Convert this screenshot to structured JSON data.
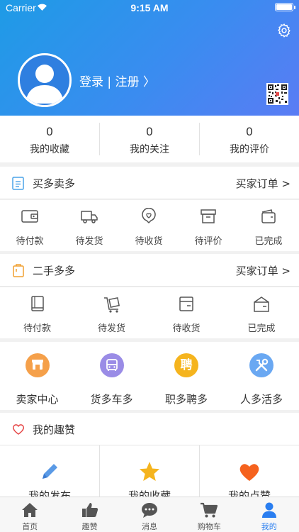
{
  "status_bar": {
    "carrier": "Carrier",
    "time": "9:15 AM"
  },
  "profile": {
    "login_text": "登录 | 注册 〉"
  },
  "stats": [
    {
      "value": "0",
      "label": "我的收藏"
    },
    {
      "value": "0",
      "label": "我的关注"
    },
    {
      "value": "0",
      "label": "我的评价"
    }
  ],
  "section_buy": {
    "title": "买多卖多",
    "link": "买家订单 >",
    "items": [
      "待付款",
      "待发货",
      "待收货",
      "待评价",
      "已完成"
    ]
  },
  "section_second": {
    "title": "二手多多",
    "link": "买家订单 >",
    "items": [
      "待付款",
      "待发货",
      "待收货",
      "已完成"
    ]
  },
  "services": [
    {
      "label": "卖家中心",
      "color": "#f5a04a"
    },
    {
      "label": "货多车多",
      "color": "#9a8ce6"
    },
    {
      "label": "职多聘多",
      "color": "#f5b41e",
      "glyph": "聘"
    },
    {
      "label": "人多活多",
      "color": "#6aa8f2"
    }
  ],
  "section_like": {
    "title": "我的趣赞"
  },
  "likes": [
    {
      "label": "我的发布"
    },
    {
      "label": "我的收藏"
    },
    {
      "label": "我的点赞"
    }
  ],
  "tabs": [
    {
      "label": "首页"
    },
    {
      "label": "趣赞"
    },
    {
      "label": "消息"
    },
    {
      "label": "购物车"
    },
    {
      "label": "我的"
    }
  ],
  "colors": {
    "accent": "#2a7ef0",
    "header_start": "#1e9be6",
    "header_end": "#5a7cf4",
    "like_heart": "#e64b4b",
    "star": "#f5b41e",
    "pen": "#5a9ae6",
    "heart": "#f5621e"
  }
}
